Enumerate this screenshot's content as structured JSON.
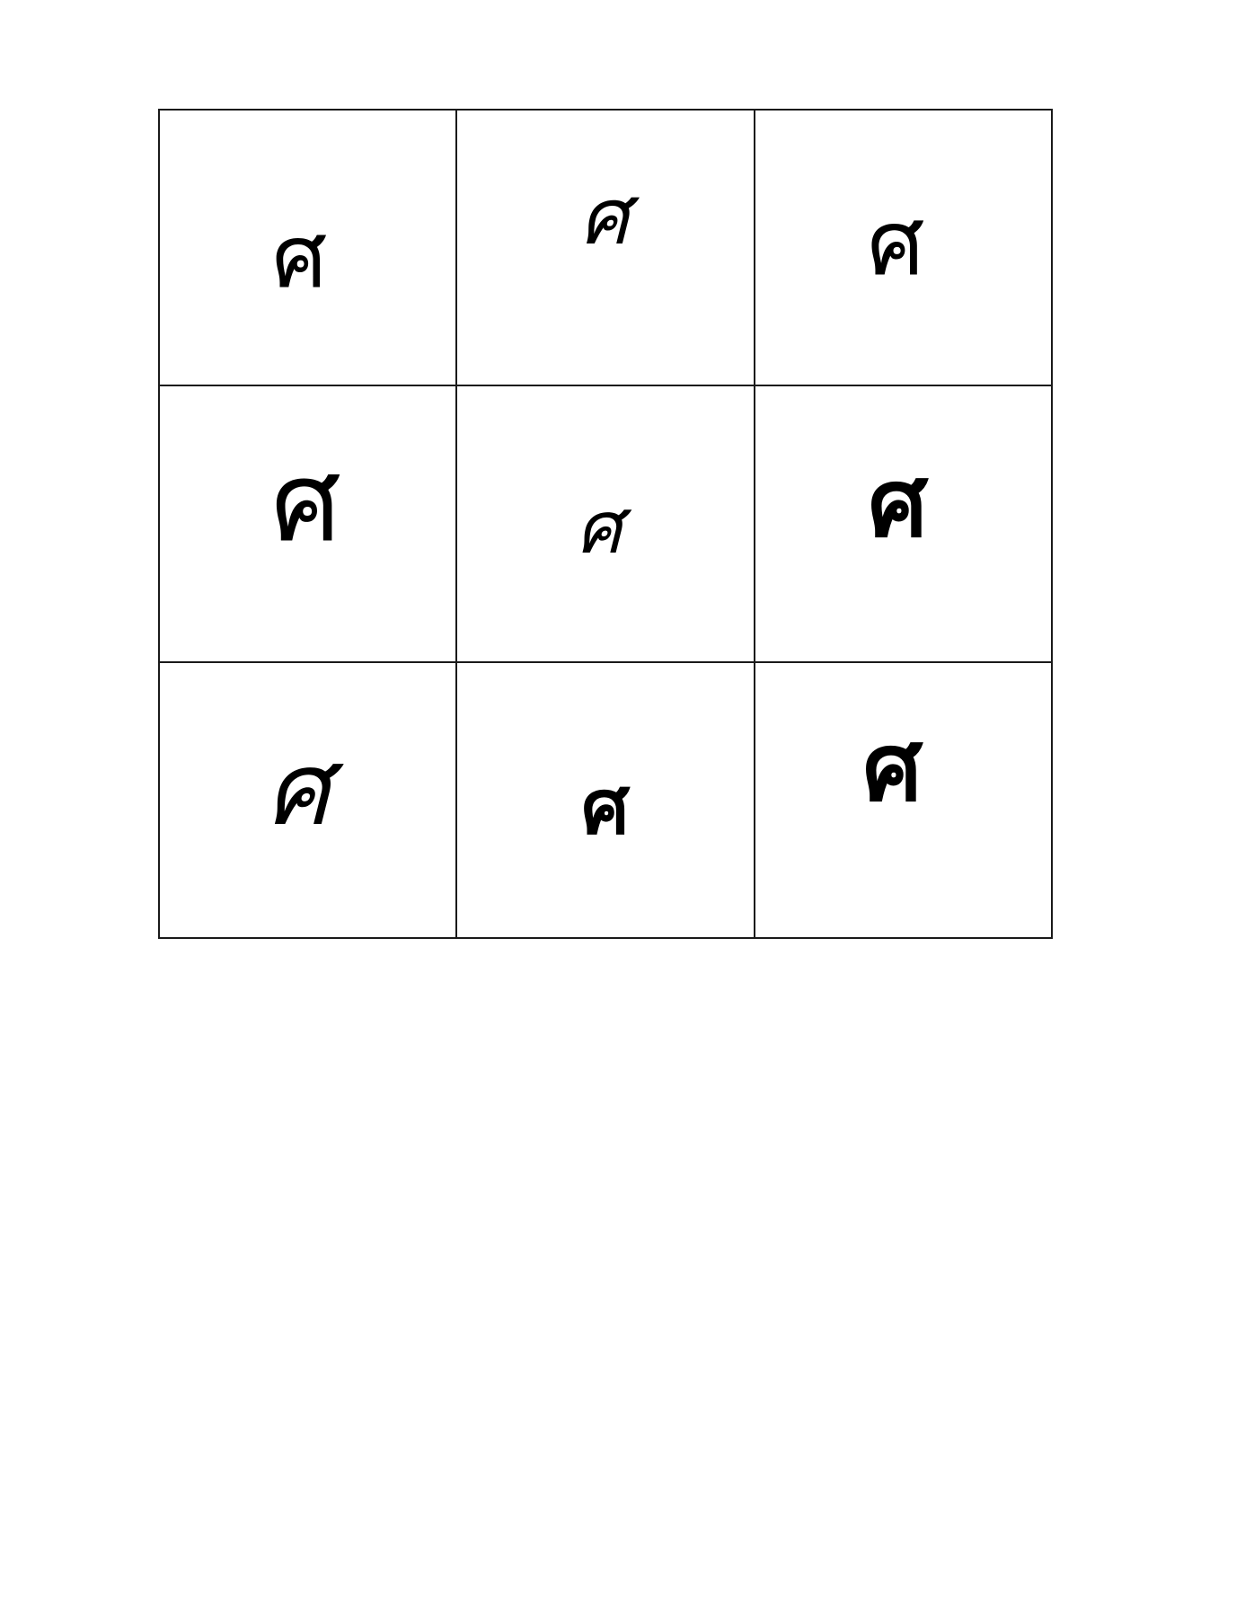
{
  "grid": {
    "cells": [
      {
        "character": "ศ"
      },
      {
        "character": "ศ"
      },
      {
        "character": "ศ"
      },
      {
        "character": "ศ"
      },
      {
        "character": "ศ"
      },
      {
        "character": "ศ"
      },
      {
        "character": "ศ"
      },
      {
        "character": "ศ"
      },
      {
        "character": "ศ"
      }
    ]
  },
  "colors": {
    "ink": "#000000",
    "border": "#1a1a1a",
    "background": "#ffffff"
  }
}
